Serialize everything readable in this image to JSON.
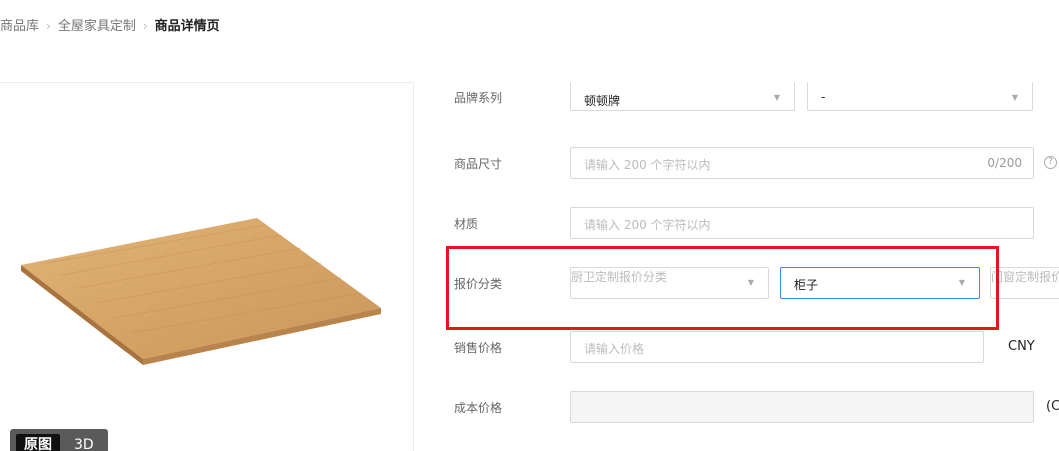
{
  "breadcrumb": {
    "items": [
      "商品库",
      "全屋家具定制",
      "商品详情页"
    ]
  },
  "preview": {
    "tabs": [
      "原图",
      "3D"
    ],
    "active_tab": "原图"
  },
  "form": {
    "brand_series": {
      "label": "品牌系列",
      "value": "顿顿牌",
      "second_value": "-"
    },
    "size": {
      "label": "商品尺寸",
      "placeholder": "请输入 200 个字符以内",
      "count": "0/200",
      "help_icon": "?"
    },
    "material": {
      "label": "材质",
      "placeholder": "请输入 200 个字符以内"
    },
    "quote_category": {
      "label": "报价分类",
      "first_placeholder": "厨卫定制报价分类",
      "second_value": "柜子",
      "third_placeholder": "门窗定制报价"
    },
    "sale_price": {
      "label": "销售价格",
      "placeholder": "请输入价格",
      "currency": "CNY"
    },
    "cost_price": {
      "label": "成本价格",
      "value": "",
      "currency": "(C"
    }
  },
  "colors": {
    "highlight": "#e4151c",
    "focus_border": "#3f87f5"
  }
}
